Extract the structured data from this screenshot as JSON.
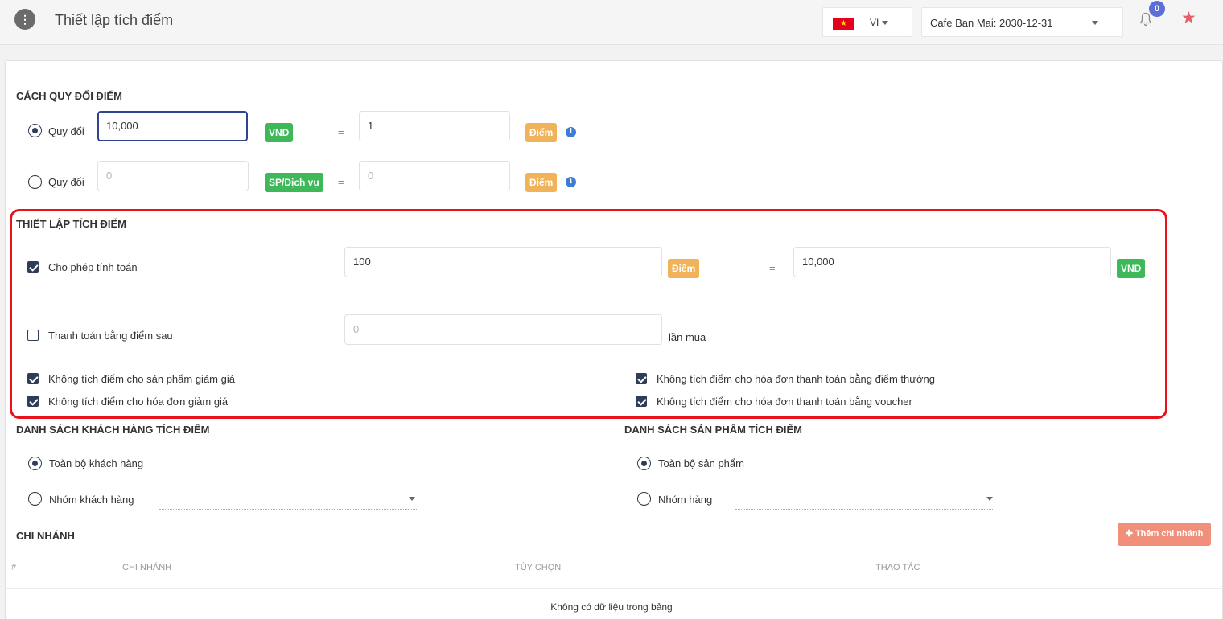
{
  "header": {
    "menu_icon": "⋮",
    "title": "Thiết lập tích điểm",
    "lang": {
      "code": "VI",
      "flag_icon": "vietnam-flag"
    },
    "store": "Cafe Ban Mai: 2030-12-31",
    "notification_count": "0",
    "star_icon": "★"
  },
  "conversion": {
    "title": "CÁCH QUY ĐỔI ĐIỂM",
    "row1": {
      "label": "Quy đổi",
      "value": "10,000",
      "unit": "VND",
      "eq": "=",
      "points_value": "1",
      "points_unit": "Điểm",
      "info": "i"
    },
    "row2": {
      "label": "Quy đổi",
      "placeholder": "0",
      "unit": "SP/Dịch vụ",
      "eq": "=",
      "points_placeholder": "0",
      "points_unit": "Điểm",
      "info": "i"
    }
  },
  "settings": {
    "title": "THIẾT LẬP TÍCH ĐIỂM",
    "allow_calc": {
      "label": "Cho phép tính toán",
      "points_value": "100",
      "points_unit": "Điểm",
      "eq": "=",
      "money_value": "10,000",
      "money_unit": "VND"
    },
    "pay_after": {
      "label": "Thanh toán bằng điểm sau",
      "placeholder": "0",
      "suffix": "lần mua"
    },
    "options": [
      "Không tích điểm cho sản phẩm giảm giá",
      "Không tích điểm cho hóa đơn giảm giá",
      "Không tích điểm cho hóa đơn thanh toán bằng điểm thưởng",
      "Không tích điểm cho hóa đơn thanh toán bằng voucher"
    ]
  },
  "customers": {
    "title": "DANH SÁCH KHÁCH HÀNG TÍCH ĐIỂM",
    "all": "Toàn bộ khách hàng",
    "group": "Nhóm khách hàng"
  },
  "products": {
    "title": "DANH SÁCH SẢN PHẨM TÍCH ĐIỂM",
    "all": "Toàn bộ sản phẩm",
    "group": "Nhóm hàng"
  },
  "branches": {
    "title": "CHI NHÁNH",
    "add_button": "✚ Thêm chi nhánh",
    "columns": [
      "#",
      "CHI NHÁNH",
      "TÙY CHỌN",
      "THAO TÁC"
    ],
    "empty": "Không có dữ liệu trong bảng"
  }
}
